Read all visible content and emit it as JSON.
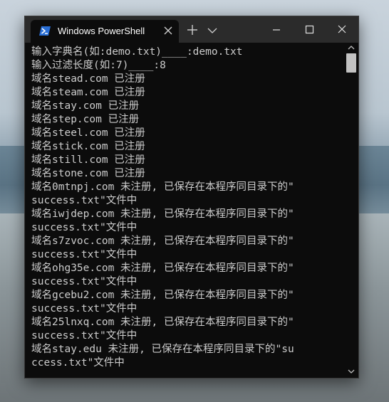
{
  "window": {
    "tab_title": "Windows PowerShell",
    "tab_icon": "powershell-icon",
    "close_tab_icon": "close-icon",
    "new_tab_icon": "plus-icon",
    "dropdown_icon": "chevron-down-icon",
    "minimize_icon": "minimize-icon",
    "maximize_icon": "maximize-icon",
    "close_icon": "close-icon"
  },
  "terminal": {
    "background": "#0c0c0c",
    "foreground": "#cccccc",
    "lines": [
      "输入字典名(如:demo.txt)____:demo.txt",
      "输入过滤长度(如:7)____:8",
      "域名stead.com 已注册",
      "域名steam.com 已注册",
      "域名stay.com 已注册",
      "域名step.com 已注册",
      "域名steel.com 已注册",
      "域名stick.com 已注册",
      "域名still.com 已注册",
      "域名stone.com 已注册",
      "域名0mtnpj.com 未注册, 已保存在本程序同目录下的\"",
      "success.txt\"文件中",
      "域名iwjdep.com 未注册, 已保存在本程序同目录下的\"",
      "success.txt\"文件中",
      "域名s7zvoc.com 未注册, 已保存在本程序同目录下的\"",
      "success.txt\"文件中",
      "域名ohg35e.com 未注册, 已保存在本程序同目录下的\"",
      "success.txt\"文件中",
      "域名gcebu2.com 未注册, 已保存在本程序同目录下的\"",
      "success.txt\"文件中",
      "域名25lnxq.com 未注册, 已保存在本程序同目录下的\"",
      "success.txt\"文件中",
      "域名stay.edu 未注册, 已保存在本程序同目录下的\"su",
      "ccess.txt\"文件中"
    ]
  },
  "scrollbar": {
    "up_icon": "scroll-up-icon",
    "down_icon": "scroll-down-icon"
  }
}
